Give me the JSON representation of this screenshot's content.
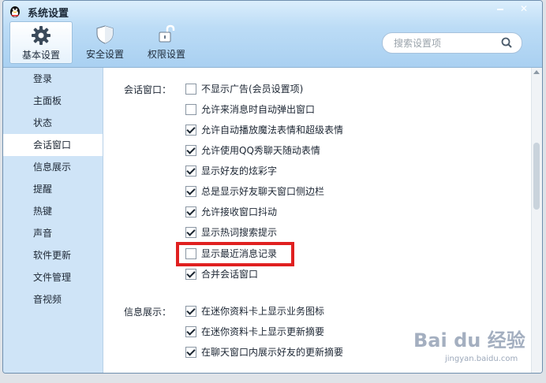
{
  "window": {
    "title": "系统设置"
  },
  "tabs": [
    {
      "label": "基本设置",
      "icon": "gear-icon",
      "active": true
    },
    {
      "label": "安全设置",
      "icon": "shield-icon",
      "active": false
    },
    {
      "label": "权限设置",
      "icon": "lock-icon",
      "active": false
    }
  ],
  "search": {
    "placeholder": "搜索设置项",
    "icon": "search-icon"
  },
  "sidebar": {
    "items": [
      {
        "label": "登录"
      },
      {
        "label": "主面板"
      },
      {
        "label": "状态"
      },
      {
        "label": "会话窗口",
        "active": true
      },
      {
        "label": "信息展示"
      },
      {
        "label": "提醒"
      },
      {
        "label": "热键"
      },
      {
        "label": "声音"
      },
      {
        "label": "软件更新"
      },
      {
        "label": "文件管理"
      },
      {
        "label": "音视频"
      }
    ]
  },
  "sections": [
    {
      "label": "会话窗口：",
      "options": [
        {
          "label": "不显示广告(会员设置项)",
          "checked": false
        },
        {
          "label": "允许来消息时自动弹出窗口",
          "checked": false
        },
        {
          "label": "允许自动播放魔法表情和超级表情",
          "checked": true
        },
        {
          "label": "允许使用QQ秀聊天随动表情",
          "checked": true
        },
        {
          "label": "显示好友的炫彩字",
          "checked": true
        },
        {
          "label": "总是显示好友聊天窗口侧边栏",
          "checked": true
        },
        {
          "label": "允许接收窗口抖动",
          "checked": true
        },
        {
          "label": "显示热词搜索提示",
          "checked": true
        },
        {
          "label": "显示最近消息记录",
          "checked": false,
          "highlighted": true
        },
        {
          "label": "合并会话窗口",
          "checked": true
        }
      ]
    },
    {
      "label": "信息展示：",
      "options": [
        {
          "label": "在迷你资料卡上显示业务图标",
          "checked": true
        },
        {
          "label": "在迷你资料卡上显示更新摘要",
          "checked": true
        },
        {
          "label": "在聊天窗口内展示好友的更新摘要",
          "checked": true
        }
      ]
    }
  ],
  "watermark": {
    "logo": "Bai du 经验",
    "url": "jingyan.baidu.com"
  },
  "colors": {
    "highlight": "#e02020",
    "sidebar_bg": "#cfe4f7",
    "topbar": "#bcdcf6"
  }
}
